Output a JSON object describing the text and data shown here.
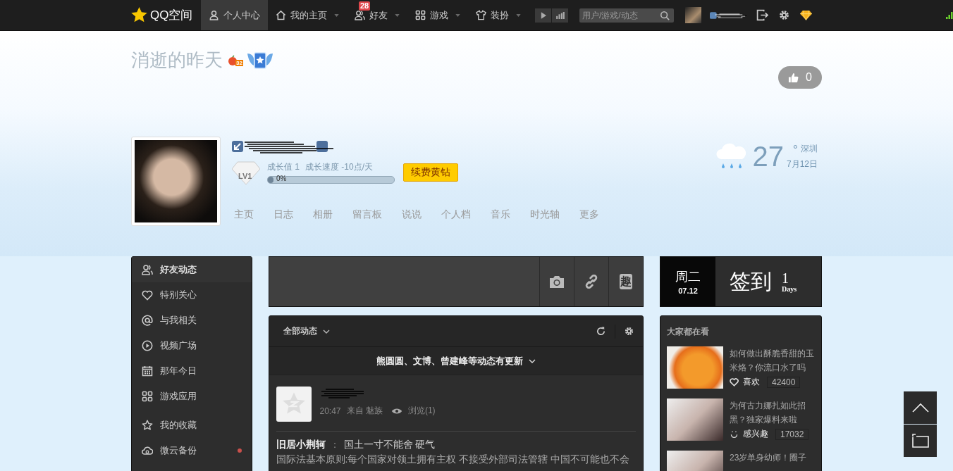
{
  "topbar": {
    "logo": "QQ空间",
    "nav": [
      {
        "label": "个人中心",
        "selected": true,
        "caret": false
      },
      {
        "label": "我的主页",
        "selected": false,
        "caret": true
      },
      {
        "label": "好友",
        "selected": false,
        "caret": true,
        "badge": "28"
      },
      {
        "label": "游戏",
        "selected": false,
        "caret": true
      },
      {
        "label": "装扮",
        "selected": false,
        "caret": true
      }
    ],
    "search": {
      "placeholder": "用户/游戏/动态"
    }
  },
  "profile": {
    "title": "消逝的昨天",
    "fruit_badge": "32",
    "growth": "成长值 1",
    "speed": "成长速度 -10点/天",
    "level_badge": "LV1",
    "progress": {
      "reading": "0%",
      "level": 0
    },
    "renew_button": "续费黄钻",
    "likes": "0",
    "weather": {
      "temperature": "27",
      "unit": "°",
      "city": "深圳",
      "date": "7月12日"
    },
    "tabs": [
      "主页",
      "日志",
      "相册",
      "留言板",
      "说说",
      "个人档",
      "音乐",
      "时光轴",
      "更多"
    ]
  },
  "sidebar": {
    "items": [
      {
        "label": "好友动态",
        "selected": true,
        "dot": false
      },
      {
        "label": "特别关心",
        "selected": false,
        "dot": false
      },
      {
        "label": "与我相关",
        "selected": false,
        "dot": false
      },
      {
        "label": "视频广场",
        "selected": false,
        "dot": false
      },
      {
        "label": "那年今日",
        "selected": false,
        "dot": false
      },
      {
        "label": "游戏应用",
        "selected": false,
        "dot": false
      },
      {
        "label": "我的收藏",
        "selected": false,
        "dot": false
      },
      {
        "label": "微云备份",
        "selected": false,
        "dot": true
      }
    ]
  },
  "composer": {
    "fun_button": "趣"
  },
  "feed": {
    "filter": "全部动态",
    "notice": "熊圆圆、文博、曾建峰等动态有更新",
    "post": {
      "time": "20:47",
      "source": "来自 魅族",
      "views": "浏览(1)",
      "author": "旧居小荆轲",
      "separator": "：",
      "text": "国土一寸不能舍 硬气",
      "body": "国际法基本原则:每个国家对领土拥有主权 不接受外部司法管辖 中国不可能也不会"
    }
  },
  "checkin": {
    "weekday": "周二",
    "date": "07.12",
    "label": "签到",
    "count": "1",
    "unit": "Days"
  },
  "trending": {
    "title": "大家都在看",
    "items": [
      {
        "title": "如何做出酥脆香甜的玉米烙？你流口水了吗",
        "action": {
          "kind": "like",
          "label": "喜欢"
        },
        "count": "42400"
      },
      {
        "title": "为何古力娜扎如此招黑？独家爆料来啦",
        "action": {
          "kind": "interest",
          "label": "感兴趣"
        },
        "count": "17032"
      },
      {
        "title": "23岁单身幼师！圈子"
      }
    ]
  }
}
